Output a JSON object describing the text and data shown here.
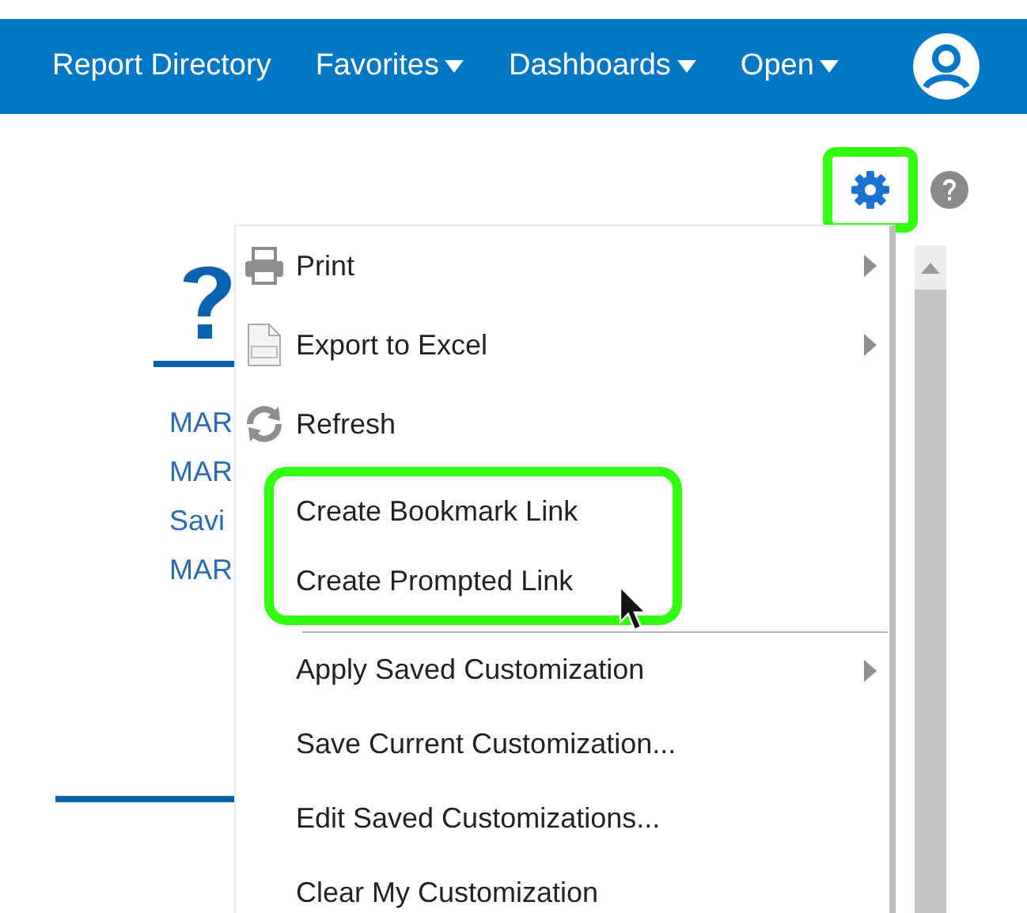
{
  "navbar": {
    "items": [
      {
        "label": "Report Directory",
        "has_dropdown": false
      },
      {
        "label": "Favorites",
        "has_dropdown": true
      },
      {
        "label": "Dashboards",
        "has_dropdown": true
      },
      {
        "label": "Open",
        "has_dropdown": true
      }
    ]
  },
  "toolbar": {
    "settings_highlighted": true
  },
  "report_links": [
    "MAR",
    "MAR",
    "Savi",
    "MAR"
  ],
  "menu": {
    "items": [
      {
        "label": "Print",
        "submenu": true,
        "highlighted": false
      },
      {
        "label": "Export to Excel",
        "submenu": true,
        "highlighted": false
      },
      {
        "label": "Refresh",
        "submenu": false,
        "highlighted": false
      },
      {
        "label": "Create Bookmark Link",
        "submenu": false,
        "highlighted": true
      },
      {
        "label": "Create Prompted Link",
        "submenu": false,
        "highlighted": true
      },
      {
        "kind": "separator"
      },
      {
        "label": "Apply Saved Customization",
        "submenu": true,
        "highlighted": false
      },
      {
        "label": "Save Current Customization...",
        "submenu": false,
        "highlighted": false
      },
      {
        "label": "Edit Saved Customizations...",
        "submenu": false,
        "highlighted": false
      },
      {
        "label": "Clear My Customization",
        "submenu": false,
        "highlighted": false
      }
    ]
  }
}
